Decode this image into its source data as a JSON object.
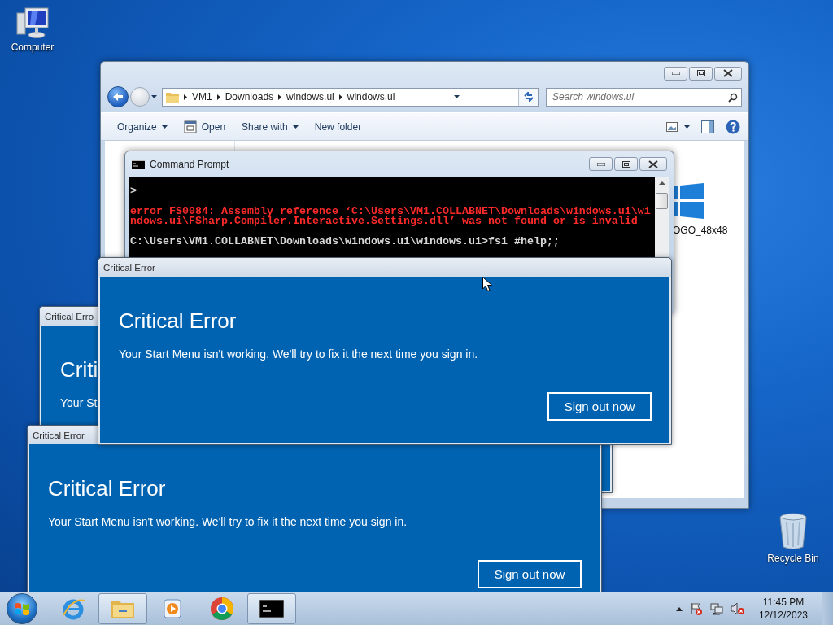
{
  "desktop_icons": [
    {
      "kind": "computer",
      "label": "Computer"
    },
    {
      "kind": "recycle_bin",
      "label": "Recycle Bin"
    }
  ],
  "explorer": {
    "breadcrumb": [
      "VM1",
      "Downloads",
      "windows.ui",
      "windows.ui"
    ],
    "search": {
      "placeholder": "Search windows.ui"
    },
    "toolbar": [
      {
        "kind": "menu",
        "label": "Organize"
      },
      {
        "kind": "open",
        "label": "Open"
      },
      {
        "kind": "menu",
        "label": "Share with"
      },
      {
        "kind": "plain",
        "label": "New folder"
      }
    ],
    "files": [
      {
        "label": "OGO_48x48"
      }
    ]
  },
  "command_prompt": {
    "title": "Command Prompt",
    "lines": [
      {
        "kind": "prompt",
        "text": ">"
      },
      {
        "kind": "error",
        "text": "error FS0084: Assembly reference ‘C:\\Users\\VM1.COLLABNET\\Downloads\\windows.ui\\wi"
      },
      {
        "kind": "error",
        "text": "ndows.ui\\FSharp.Compiler.Interactive.Settings.dll’ was not found or is invalid"
      },
      {
        "kind": "command",
        "text": "C:\\Users\\VM1.COLLABNET\\Downloads\\windows.ui\\windows.ui>fsi #help;;"
      }
    ]
  },
  "dialogs": [
    {
      "title": "Critical Erro",
      "heading": "Criti",
      "message": "Your St"
    },
    {
      "title": "Critical Error",
      "heading": "Critical Error",
      "message": "Your Start Menu isn't working. We'll try to fix it the next time you sign in.",
      "button": "Sign out now"
    },
    {
      "title": "Critical Error",
      "heading": "Critical Error",
      "message": "Your Start Menu isn't working. We'll try to fix it the next time you sign in.",
      "button": "Sign out now"
    }
  ],
  "taskbar": {
    "apps": [
      {
        "kind": "ie",
        "open": false
      },
      {
        "kind": "explorer",
        "open": true
      },
      {
        "kind": "media",
        "open": false
      },
      {
        "kind": "chrome",
        "open": false
      },
      {
        "kind": "console",
        "open": true
      }
    ],
    "clock": {
      "time": "11:45 PM",
      "date": "12/12/2023"
    }
  }
}
